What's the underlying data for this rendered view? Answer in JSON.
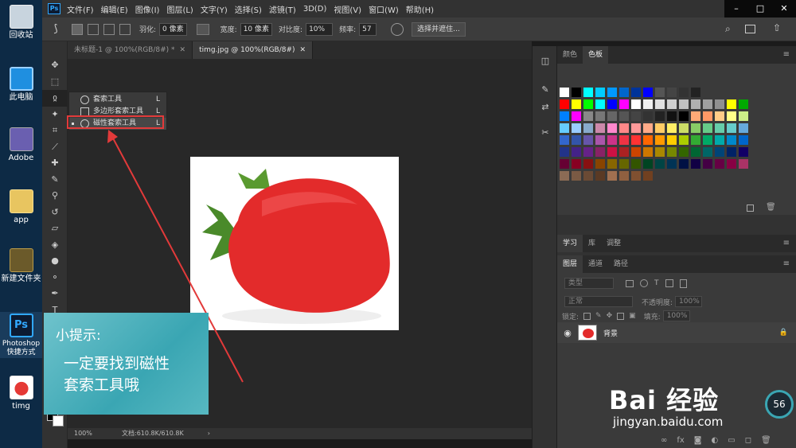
{
  "desktop": {
    "icons": [
      {
        "label": "回收站"
      },
      {
        "label": "此电脑"
      },
      {
        "label": "Adobe"
      },
      {
        "label": "app"
      },
      {
        "label": "新建文件夹"
      },
      {
        "label": "Photoshop\n快捷方式"
      },
      {
        "label": "timg"
      }
    ]
  },
  "menubar": {
    "logo": "Ps",
    "items": [
      "文件(F)",
      "编辑(E)",
      "图像(I)",
      "图层(L)",
      "文字(Y)",
      "选择(S)",
      "滤镜(T)",
      "3D(D)",
      "视图(V)",
      "窗口(W)",
      "帮助(H)"
    ]
  },
  "options": {
    "feather_label": "羽化:",
    "feather_value": "0 像素",
    "width_label": "宽度:",
    "width_value": "10 像素",
    "contrast_label": "对比度:",
    "contrast_value": "10%",
    "frequency_label": "频率:",
    "frequency_value": "57",
    "select_mask_button": "选择并遮住..."
  },
  "doc_tabs": [
    {
      "label": "未标题-1 @ 100%(RGB/8#) *",
      "active": false
    },
    {
      "label": "timg.jpg @ 100%(RGB/8#)",
      "active": true
    }
  ],
  "flyout": {
    "items": [
      {
        "label": "套索工具",
        "key": "L"
      },
      {
        "label": "多边形套索工具",
        "key": "L"
      },
      {
        "label": "磁性套索工具",
        "key": "L"
      }
    ]
  },
  "tip": {
    "title": "小提示:",
    "line1": "一定要找到磁性",
    "line2": "套索工具哦"
  },
  "status": {
    "zoom": "100%",
    "doc": "文档:610.8K/610.8K"
  },
  "swatch_panel": {
    "tabs": [
      "颜色",
      "色板"
    ],
    "active_tab": "色板"
  },
  "learn_panel": {
    "tabs": [
      "学习",
      "库",
      "调整"
    ]
  },
  "layers_panel": {
    "tabs": [
      "图层",
      "通道",
      "路径"
    ],
    "kind_filter": "类型",
    "blend_mode": "正常",
    "opacity_label": "不透明度:",
    "opacity_value": "100%",
    "lock_label": "锁定:",
    "fill_label": "填充:",
    "fill_value": "100%",
    "layer_name": "背景"
  },
  "watermark": {
    "logo": "Bai 经验",
    "url": "jingyan.baidu.com"
  },
  "gauge": {
    "value": "56"
  },
  "swatches": {
    "colors": [
      [
        "#ffffff",
        "#000000",
        "#00ffff",
        "#00ccff",
        "#0099ff",
        "#0066cc",
        "#003399",
        "#0000ff",
        "#555555",
        "#444444",
        "#333333",
        "#222222"
      ],
      [
        "#ff0000",
        "#ffff00",
        "#00ff00",
        "#00ffff",
        "#0000ff",
        "#ff00ff",
        "#ffffff",
        "#f0f0f0",
        "#e0e0e0",
        "#d0d0d0",
        "#c0c0c0",
        "#b0b0b0",
        "#a0a0a0",
        "#909090",
        "#ffff00",
        "#00aa00"
      ],
      [
        "#0080ff",
        "#ff00ff",
        "#888888",
        "#777777",
        "#666666",
        "#555555",
        "#444444",
        "#333333",
        "#222222",
        "#111111",
        "#000000",
        "#ffaa77",
        "#ff9966",
        "#ffcc88",
        "#ffff88",
        "#ccee88"
      ],
      [
        "#66ccff",
        "#99ccff",
        "#88aacc",
        "#cc88aa",
        "#ff88cc",
        "#ff8888",
        "#ff9999",
        "#ffaa88",
        "#ffcc66",
        "#ffee66",
        "#ccdd66",
        "#88cc66",
        "#66cc88",
        "#66ccaa",
        "#66cccc",
        "#66aadd"
      ],
      [
        "#3366cc",
        "#3355aa",
        "#6655aa",
        "#aa55aa",
        "#cc3388",
        "#ee3344",
        "#ff3333",
        "#ff6600",
        "#ff9900",
        "#ffcc00",
        "#aacc00",
        "#33aa33",
        "#00aa66",
        "#00aaaa",
        "#0088cc",
        "#0066cc"
      ],
      [
        "#223388",
        "#442288",
        "#662288",
        "#882266",
        "#cc1144",
        "#aa2222",
        "#cc4400",
        "#cc7700",
        "#aa8800",
        "#778800",
        "#336600",
        "#006633",
        "#006666",
        "#004477",
        "#002266",
        "#110066"
      ],
      [
        "#660033",
        "#880022",
        "#881111",
        "#884400",
        "#886600",
        "#666600",
        "#335500",
        "#004422",
        "#004444",
        "#003355",
        "#001144",
        "#110044",
        "#440044",
        "#660044",
        "#880044",
        "#aa3366"
      ],
      [
        "#8b6b55",
        "#7a5a44",
        "#6a4a34",
        "#5a3a24",
        "#a07050",
        "#906040",
        "#805030",
        "#704020"
      ]
    ]
  }
}
